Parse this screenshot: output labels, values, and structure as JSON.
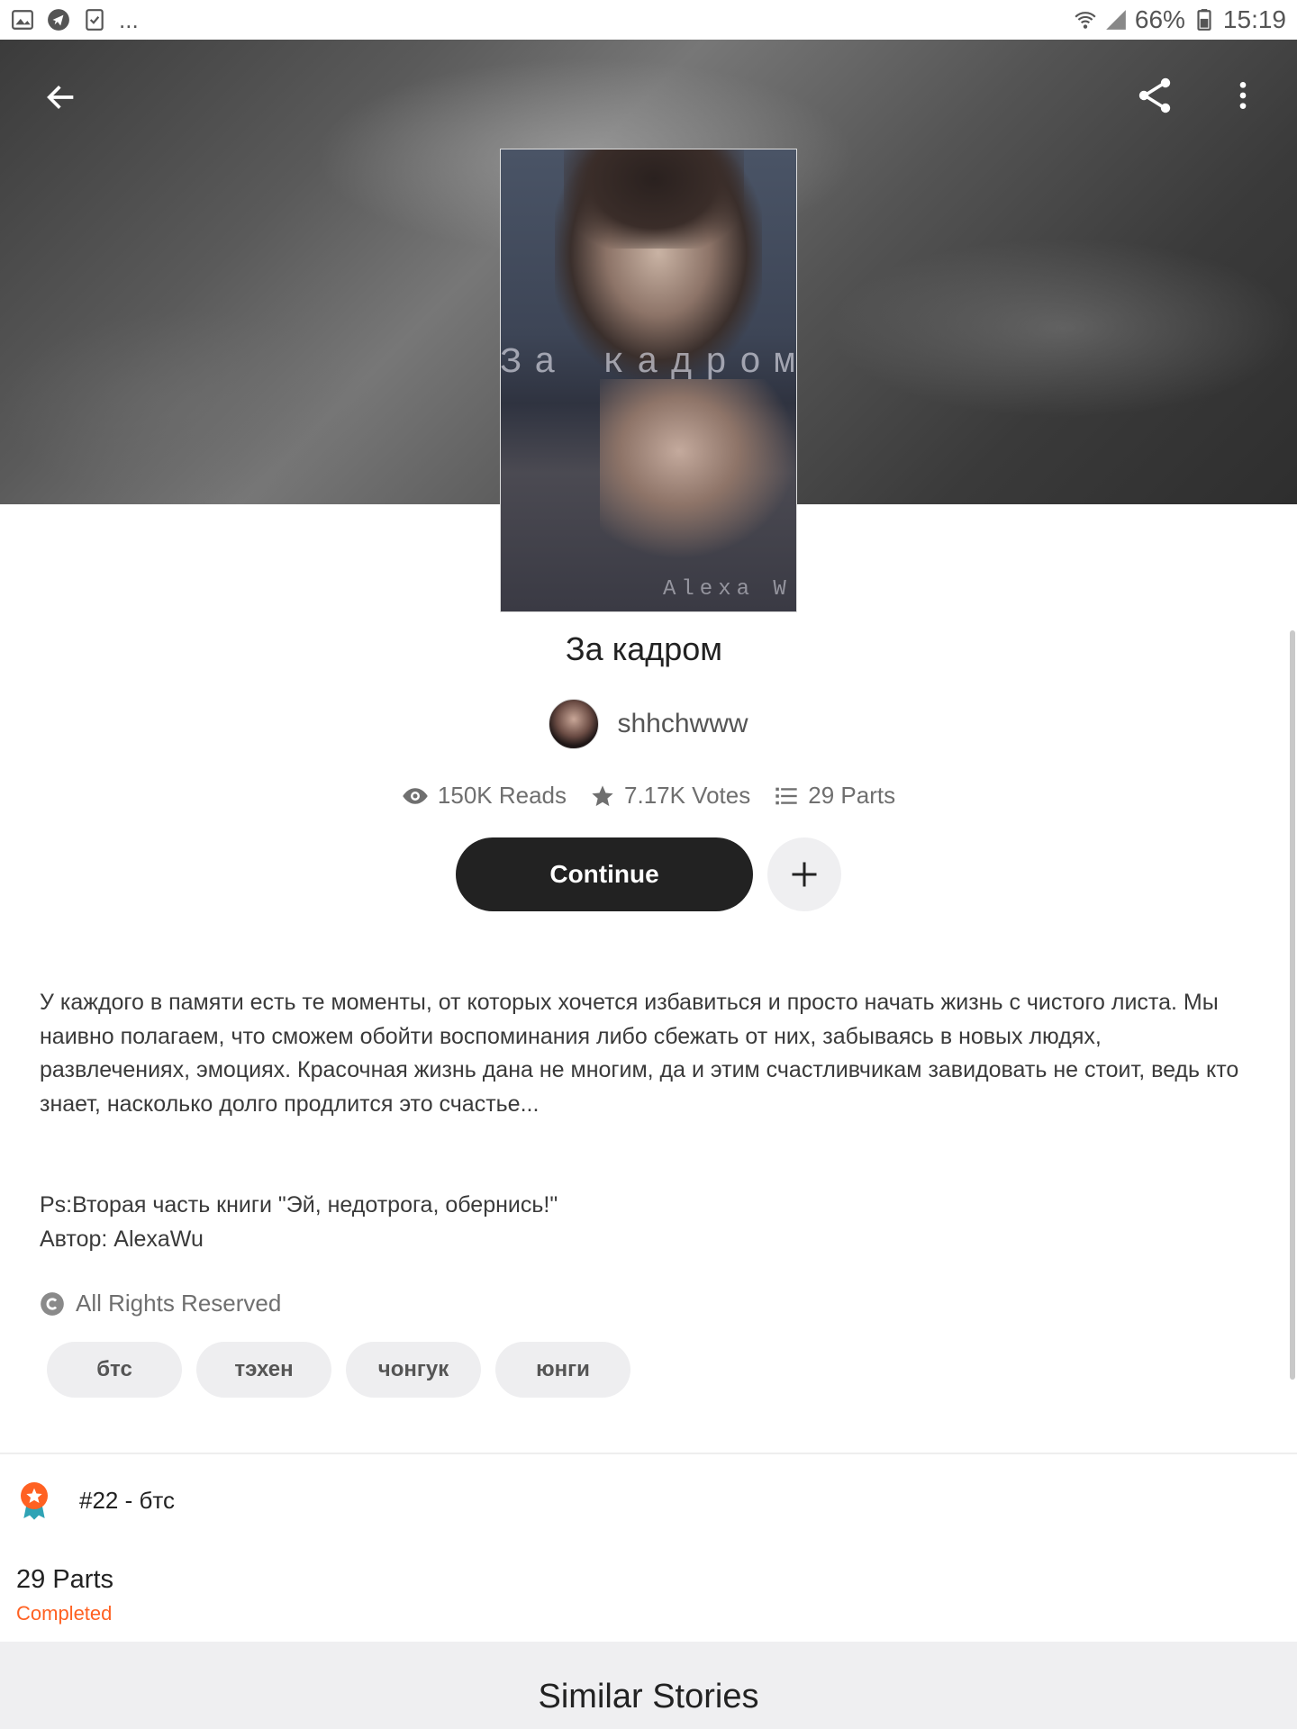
{
  "status_bar": {
    "left_more": "...",
    "battery": "66%",
    "time": "15:19"
  },
  "header": {
    "back_icon": "arrow-left-icon",
    "share_icon": "share-icon",
    "more_icon": "more-vert-icon"
  },
  "cover": {
    "title_overlay": "За кадром",
    "author_overlay": "Alexa W"
  },
  "story": {
    "title": "За кадром",
    "author": "shhchwww",
    "stats": {
      "reads": "150K Reads",
      "votes": "7.17K Votes",
      "parts": "29 Parts"
    },
    "continue_label": "Continue",
    "description": "У каждого в памяти есть те моменты, от которых хочется избавиться и просто начать жизнь с чистого листа. Мы наивно полагаем, что сможем обойти воспоминания либо сбежать от них, забываясь в новых людях, развлечениях, эмоциях. Красочная жизнь дана не многим, да и этим счастливчикам завидовать не стоит, ведь кто знает, насколько долго продлится это счастье...",
    "ps_line1": "Ps:Вторая часть книги \"Эй, недотрога, обернись!\"",
    "ps_line2": "Автор: AlexaWu",
    "copyright": "All Rights Reserved",
    "tags": [
      "бтс",
      "тэхен",
      "чонгук",
      "юнги"
    ],
    "rank": "#22 - бтс",
    "parts_count": "29 Parts",
    "parts_status": "Completed"
  },
  "similar": {
    "title": "Similar Stories"
  },
  "colors": {
    "accent": "#ff6122",
    "button_dark": "#222222",
    "tag_bg": "#eeeef0"
  }
}
